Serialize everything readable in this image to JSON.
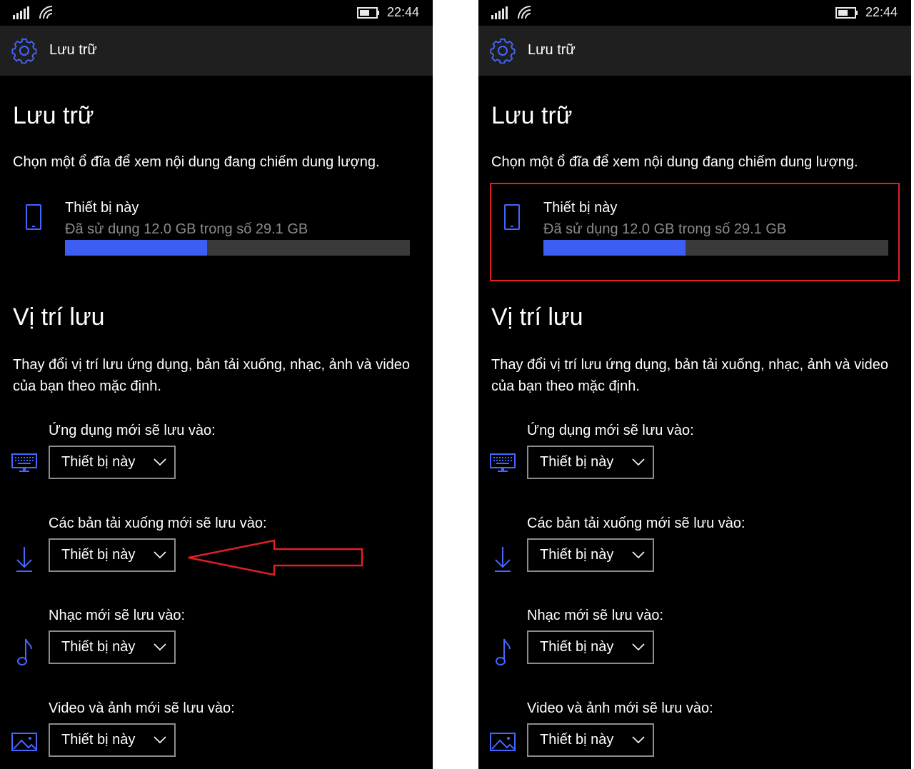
{
  "status_bar": {
    "time": "22:44"
  },
  "app_bar": {
    "title": "Lưu trữ"
  },
  "storage": {
    "title": "Lưu trữ",
    "description": "Chọn một ổ đĩa để xem nội dung đang chiếm dung lượng.",
    "device": {
      "name": "Thiết bị này",
      "usage_text": "Đã sử dụng 12.0 GB trong số 29.1 GB",
      "used_gb": 12.0,
      "total_gb": 29.1
    }
  },
  "locations": {
    "title": "Vị trí lưu",
    "description": "Thay đổi vị trí lưu ứng dụng, bản tải xuống, nhạc, ảnh và video của bạn theo mặc định.",
    "settings": [
      {
        "label": "Ứng dụng mới sẽ lưu vào:",
        "value": "Thiết bị này",
        "icon": "keyboard-icon"
      },
      {
        "label": "Các bản tải xuống mới sẽ lưu vào:",
        "value": "Thiết bị này",
        "icon": "download-icon"
      },
      {
        "label": "Nhạc mới sẽ lưu vào:",
        "value": "Thiết bị này",
        "icon": "music-note-icon"
      },
      {
        "label": "Video và ảnh mới sẽ lưu vào:",
        "value": "Thiết bị này",
        "icon": "image-icon"
      }
    ]
  },
  "colors": {
    "accent": "#3c5ef3",
    "annotation": "#e01f26",
    "background": "#000000",
    "app_bar": "#1f1f1f",
    "usage_track": "#3a3a3a"
  }
}
